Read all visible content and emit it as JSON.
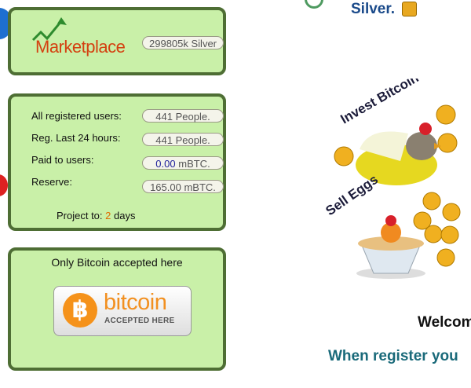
{
  "header": {
    "silver_text": "Silver."
  },
  "marketplace": {
    "logo_text": "Marketplace",
    "silver_balance": "299805k Silver"
  },
  "stats": {
    "rows": [
      {
        "label": "All registered users:",
        "value": "441 People."
      },
      {
        "label": "Reg. Last 24 hours:",
        "value": "441 People."
      },
      {
        "label": "Paid to users:",
        "value_number": "0.00",
        "value_unit": "mBTC."
      },
      {
        "label": "Reserve:",
        "value": "165.00 mBTC."
      }
    ],
    "project_prefix": "Project to:",
    "project_days_number": "2",
    "project_days_unit": "days"
  },
  "payment": {
    "title": "Only Bitcoin accepted here",
    "badge_word": "bitcoin",
    "badge_sub": "ACCEPTED HERE",
    "badge_symbol": "฿"
  },
  "art": {
    "invest_text": "Invest Bitcoin",
    "sell_text": "Sell Eggs"
  },
  "main": {
    "welcome": "Welcom",
    "register": "When register you"
  }
}
